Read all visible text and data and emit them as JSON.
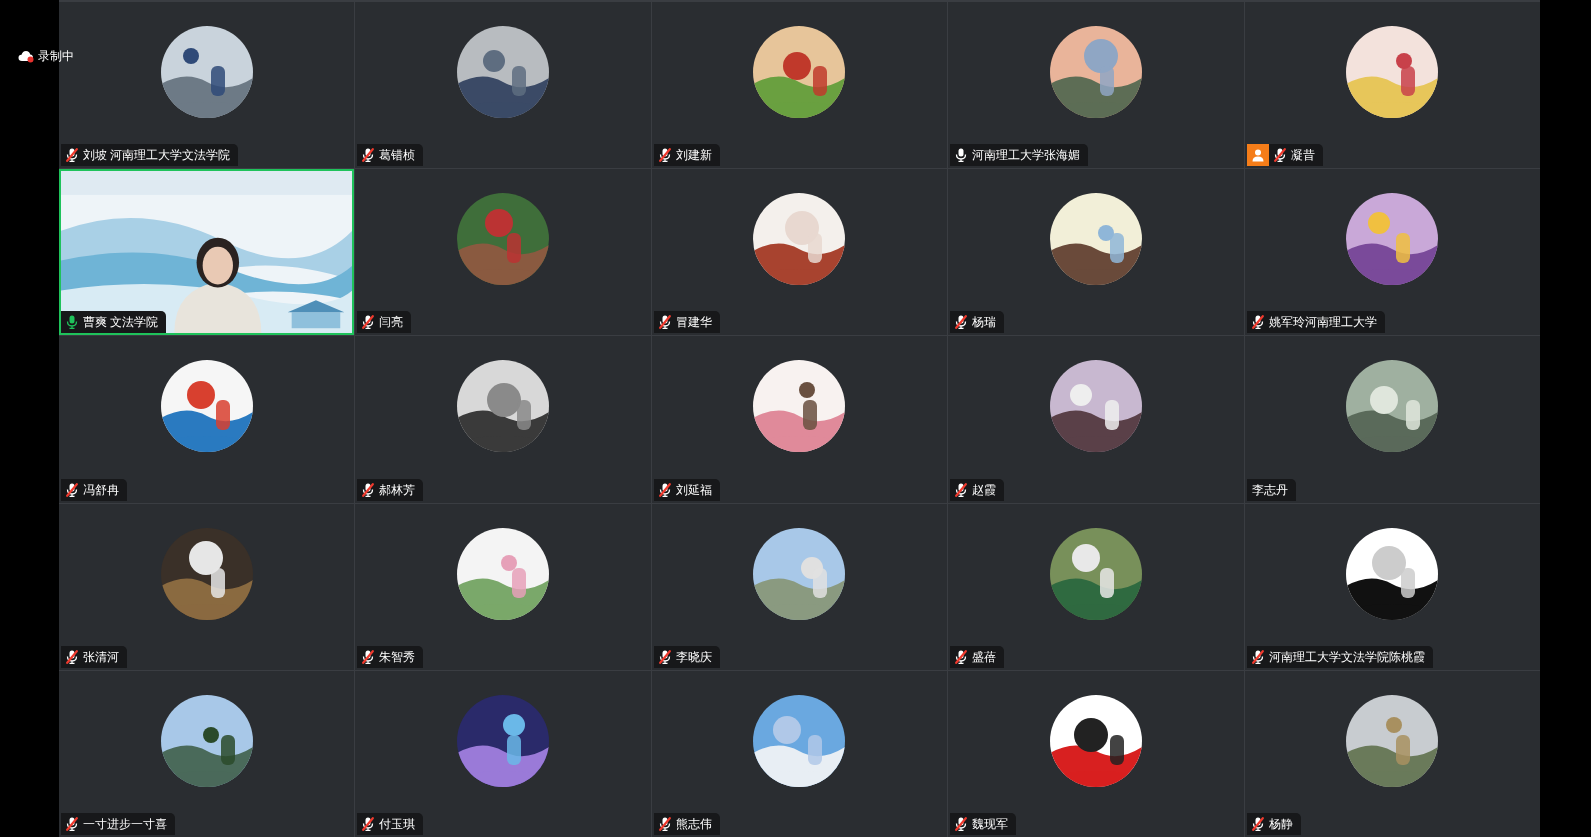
{
  "recording": {
    "label": "录制中"
  },
  "participants": [
    {
      "name": "刘坡 河南理工大学文法学院",
      "mic_shown": true,
      "muted": true,
      "video": false,
      "speaking": false,
      "badge": false
    },
    {
      "name": "葛错桢",
      "mic_shown": true,
      "muted": true,
      "video": false,
      "speaking": false,
      "badge": false
    },
    {
      "name": "刘建新",
      "mic_shown": true,
      "muted": true,
      "video": false,
      "speaking": false,
      "badge": false
    },
    {
      "name": "河南理工大学张海媚",
      "mic_shown": true,
      "muted": false,
      "video": false,
      "speaking": false,
      "badge": false
    },
    {
      "name": "凝昔",
      "mic_shown": true,
      "muted": true,
      "video": false,
      "speaking": false,
      "badge": true
    },
    {
      "name": "曹爽 文法学院",
      "mic_shown": true,
      "muted": false,
      "video": true,
      "speaking": true,
      "badge": false
    },
    {
      "name": "闫亮",
      "mic_shown": true,
      "muted": true,
      "video": false,
      "speaking": false,
      "badge": false
    },
    {
      "name": "冒建华",
      "mic_shown": true,
      "muted": true,
      "video": false,
      "speaking": false,
      "badge": false
    },
    {
      "name": "杨瑞",
      "mic_shown": true,
      "muted": true,
      "video": false,
      "speaking": false,
      "badge": false
    },
    {
      "name": "姚军玲河南理工大学",
      "mic_shown": true,
      "muted": true,
      "video": false,
      "speaking": false,
      "badge": false
    },
    {
      "name": "冯舒冉",
      "mic_shown": true,
      "muted": true,
      "video": false,
      "speaking": false,
      "badge": false
    },
    {
      "name": "郝林芳",
      "mic_shown": true,
      "muted": true,
      "video": false,
      "speaking": false,
      "badge": false
    },
    {
      "name": "刘延福",
      "mic_shown": true,
      "muted": true,
      "video": false,
      "speaking": false,
      "badge": false
    },
    {
      "name": "赵霞",
      "mic_shown": true,
      "muted": true,
      "video": false,
      "speaking": false,
      "badge": false
    },
    {
      "name": "李志丹",
      "mic_shown": false,
      "video": false,
      "speaking": false,
      "badge": false
    },
    {
      "name": "张清河",
      "mic_shown": true,
      "muted": true,
      "video": false,
      "speaking": false,
      "badge": false
    },
    {
      "name": "朱智秀",
      "mic_shown": true,
      "muted": true,
      "video": false,
      "speaking": false,
      "badge": false
    },
    {
      "name": "李晓庆",
      "mic_shown": true,
      "muted": true,
      "video": false,
      "speaking": false,
      "badge": false
    },
    {
      "name": "盛蓓",
      "mic_shown": true,
      "muted": true,
      "video": false,
      "speaking": false,
      "badge": false
    },
    {
      "name": "河南理工大学文法学院陈桃霞",
      "mic_shown": true,
      "muted": true,
      "video": false,
      "speaking": false,
      "badge": false
    },
    {
      "name": "一寸进步一寸喜",
      "mic_shown": true,
      "muted": true,
      "video": false,
      "speaking": false,
      "badge": false
    },
    {
      "name": "付玉琪",
      "mic_shown": true,
      "muted": true,
      "video": false,
      "speaking": false,
      "badge": false
    },
    {
      "name": "熊志伟",
      "mic_shown": true,
      "muted": true,
      "video": false,
      "speaking": false,
      "badge": false
    },
    {
      "name": "魏现军",
      "mic_shown": true,
      "muted": true,
      "video": false,
      "speaking": false,
      "badge": false
    },
    {
      "name": "杨静",
      "mic_shown": true,
      "muted": true,
      "video": false,
      "speaking": false,
      "badge": false
    }
  ]
}
